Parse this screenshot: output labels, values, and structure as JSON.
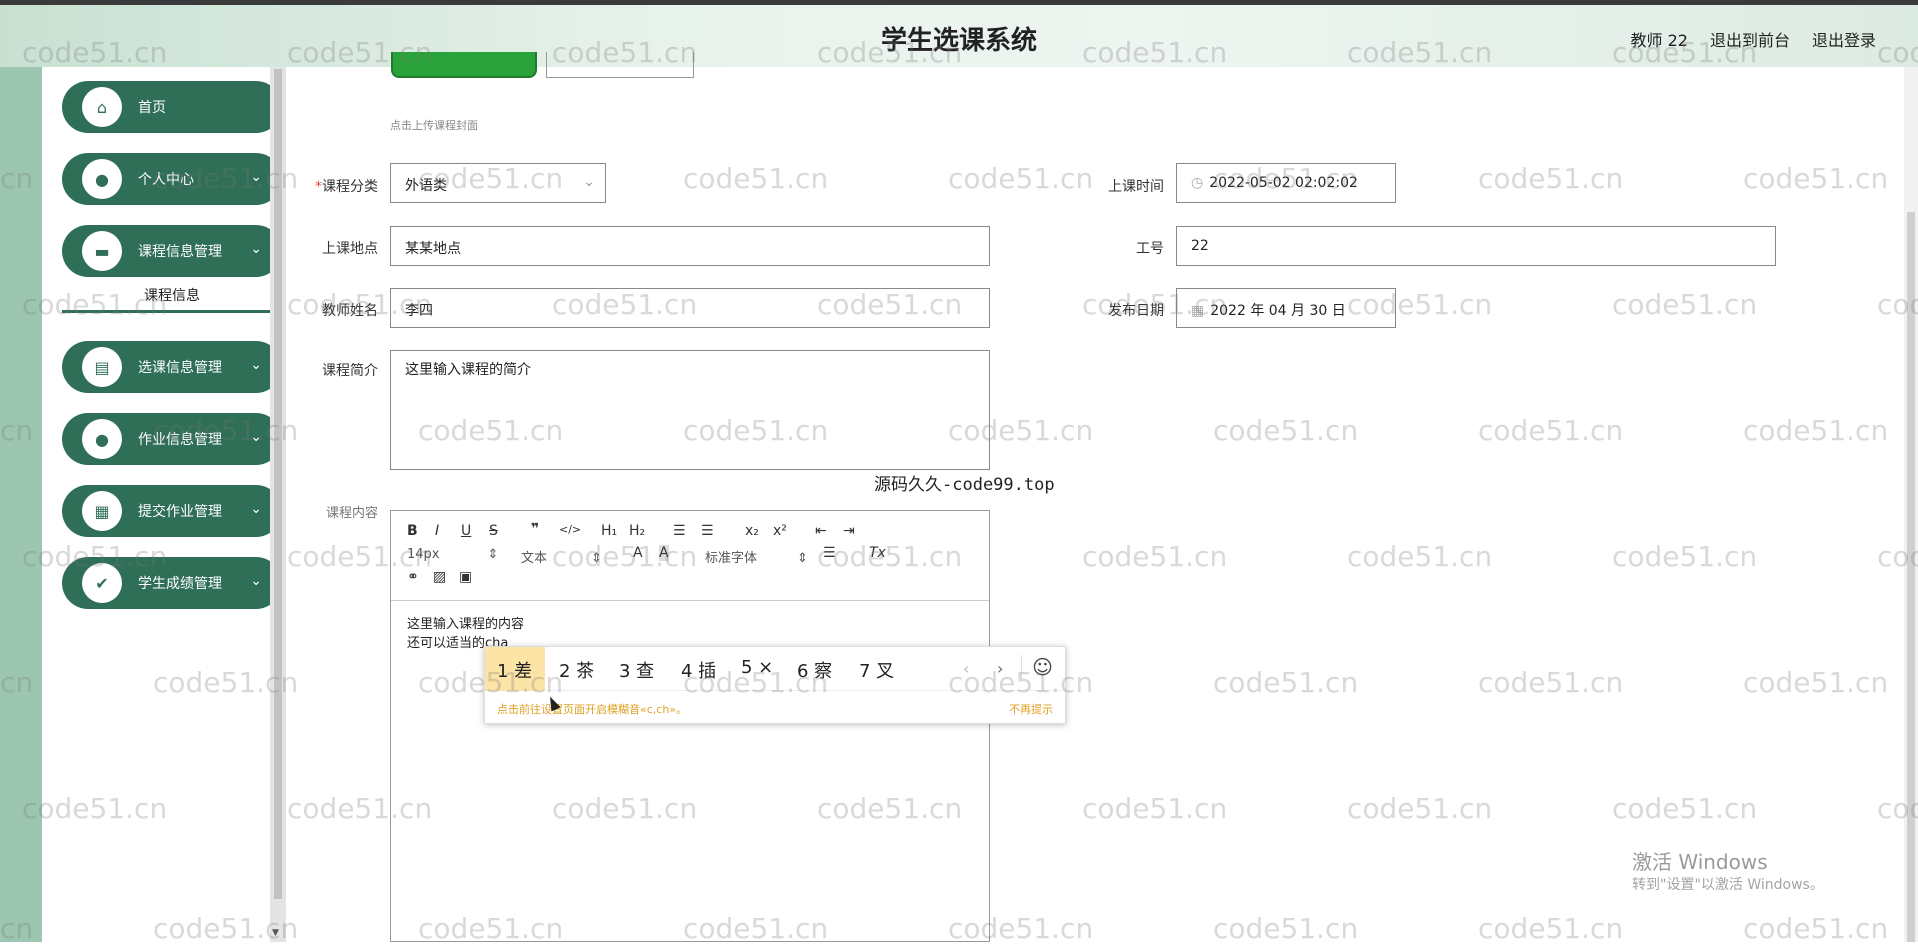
{
  "header": {
    "title": "学生选课系统",
    "user": "教师 22",
    "to_front": "退出到前台",
    "logout": "退出登录"
  },
  "sidebar": {
    "items": [
      {
        "label": "首页",
        "icon": "home-icon"
      },
      {
        "label": "个人中心",
        "icon": "user-icon"
      },
      {
        "label": "课程信息管理",
        "icon": "monitor-icon"
      },
      {
        "label": "选课信息管理",
        "icon": "clipboard-icon"
      },
      {
        "label": "作业信息管理",
        "icon": "user-icon"
      },
      {
        "label": "提交作业管理",
        "icon": "grid-icon"
      },
      {
        "label": "学生成绩管理",
        "icon": "checklist-icon"
      }
    ],
    "sub_item": "课程信息"
  },
  "form": {
    "upload_hint": "点击上传课程封面",
    "category_label": "课程分类",
    "category_value": "外语类",
    "time_label": "上课时间",
    "time_value": "2022-05-02 02:02:02",
    "place_label": "上课地点",
    "place_value": "某某地点",
    "job_no_label": "工号",
    "job_no_value": "22",
    "teacher_label": "教师姓名",
    "teacher_value": "李四",
    "publish_label": "发布日期",
    "publish_value": "2022 年 04 月 30 日",
    "intro_label": "课程简介",
    "intro_value": "这里输入课程的简介",
    "content_label": "课程内容"
  },
  "editor": {
    "font_size": "14px",
    "text_style": "文本",
    "font_family": "标准字体",
    "content_line1": "这里输入课程的内容",
    "content_line2": "还可以适当的",
    "content_typing": "cha"
  },
  "ime": {
    "candidates": [
      "1 差",
      "2 茶",
      "3 查",
      "4 插",
      "5 ×",
      "6 察",
      "7 叉"
    ],
    "tip": "点击前往设置页面开启模糊音«c,ch»。",
    "dismiss": "不再提示"
  },
  "overlay": {
    "source_mark": "源码久久-code99.top",
    "watermark": "code51.cn",
    "activate_title": "激活 Windows",
    "activate_sub": "转到\"设置\"以激活 Windows。"
  }
}
